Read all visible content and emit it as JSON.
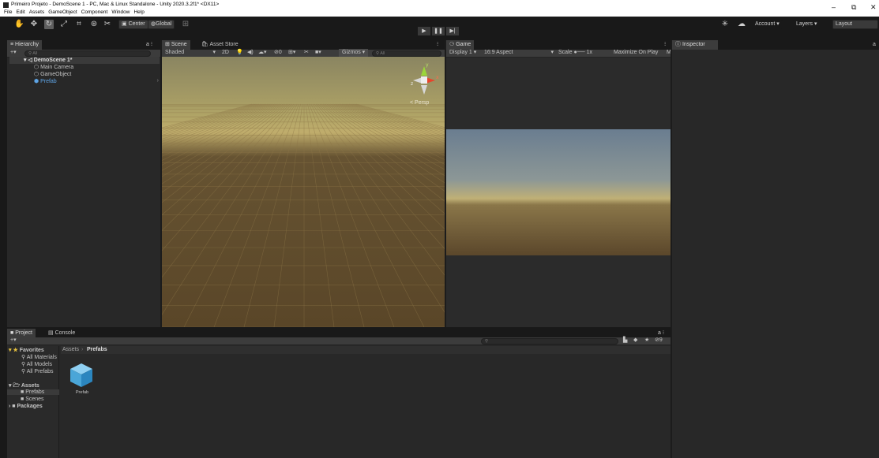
{
  "window": {
    "title": "Primeiro Projeto - DemoScene 1 - PC, Mac & Linux Standalone - Unity 2020.3.2f1* <DX11>",
    "menu": [
      "File",
      "Edit",
      "Assets",
      "GameObject",
      "Component",
      "Window",
      "Help"
    ],
    "controls": {
      "minimize": "–",
      "maximize": "⧉",
      "close": "✕"
    }
  },
  "toolbar": {
    "pivot": "Center",
    "space": "Global",
    "play": "▶",
    "pause": "❚❚",
    "step": "▶|",
    "account": "Account",
    "layers": "Layers",
    "layout": "Layout"
  },
  "hierarchy": {
    "tab": "Hierarchy",
    "add": "+▾",
    "search_placeholder": "All",
    "scene": "DemoScene 1*",
    "items": [
      "Main Camera",
      "GameObject",
      "Prefab"
    ]
  },
  "scene_panel": {
    "tabs": [
      "Scene",
      "Asset Store"
    ],
    "shading": "Shaded",
    "mode_2d": "2D",
    "fx": "0",
    "gizmos": "Gizmos",
    "search_placeholder": "All",
    "persp": "< Persp",
    "gizmo_axes": {
      "y": "y",
      "x": "x",
      "z": "z"
    }
  },
  "game_panel": {
    "tab": "Game",
    "display": "Display 1",
    "aspect": "16:9 Aspect",
    "scale_label": "Scale",
    "scale_value": "1x",
    "maximize": "Maximize On Play",
    "mute": "M"
  },
  "inspector": {
    "tab": "Inspector"
  },
  "project": {
    "tabs": [
      "Project",
      "Console"
    ],
    "add": "+▾",
    "favorites": {
      "label": "Favorites",
      "items": [
        "All Materials",
        "All Models",
        "All Prefabs"
      ]
    },
    "assets": {
      "label": "Assets",
      "items": [
        "Prefabs",
        "Scenes"
      ]
    },
    "packages": "Packages",
    "breadcrumb": [
      "Assets",
      "Prefabs"
    ],
    "asset_items": [
      "Prefab"
    ],
    "hidden_count": "9"
  }
}
